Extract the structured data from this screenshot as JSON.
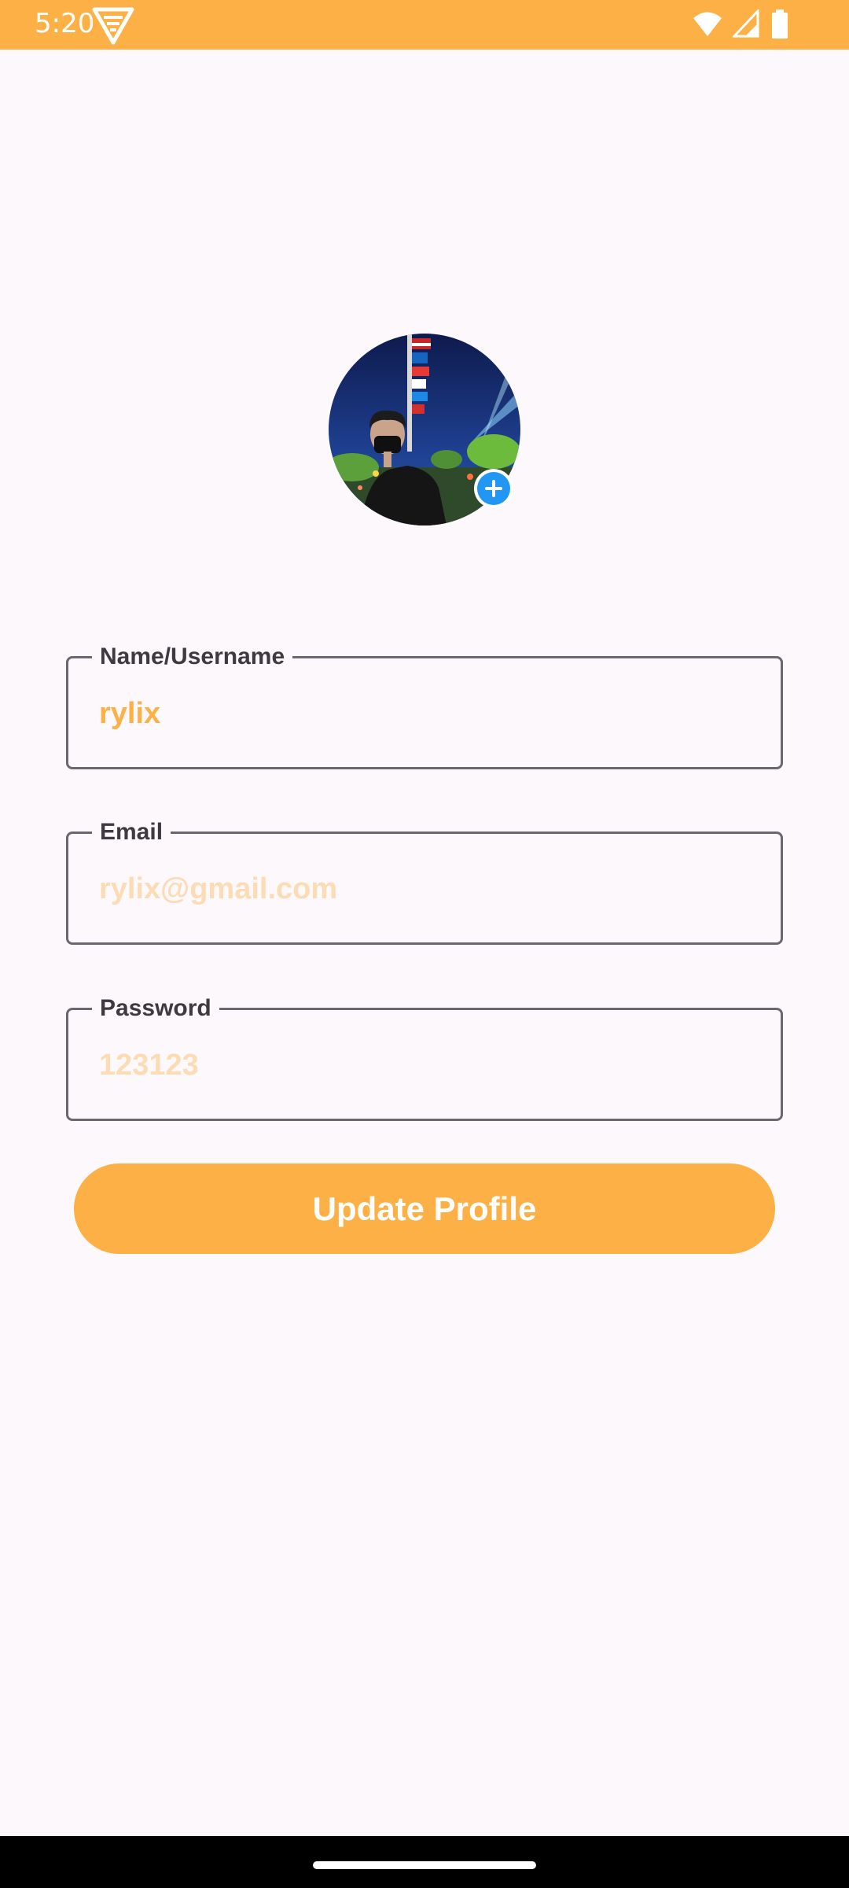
{
  "status_bar": {
    "time": "5:20",
    "background_color": "#fcb045",
    "icons": [
      "wifi-icon",
      "signal-icon",
      "battery-icon"
    ]
  },
  "avatar": {
    "add_icon": "plus-circle-icon",
    "add_icon_color": "#2196f3"
  },
  "form": {
    "name": {
      "label": "Name/Username",
      "value": "rylix"
    },
    "email": {
      "label": "Email",
      "placeholder": "rylix@gmail.com"
    },
    "password": {
      "label": "Password",
      "placeholder": "123123"
    }
  },
  "update_button": {
    "label": "Update Profile",
    "color": "#fcb045"
  }
}
